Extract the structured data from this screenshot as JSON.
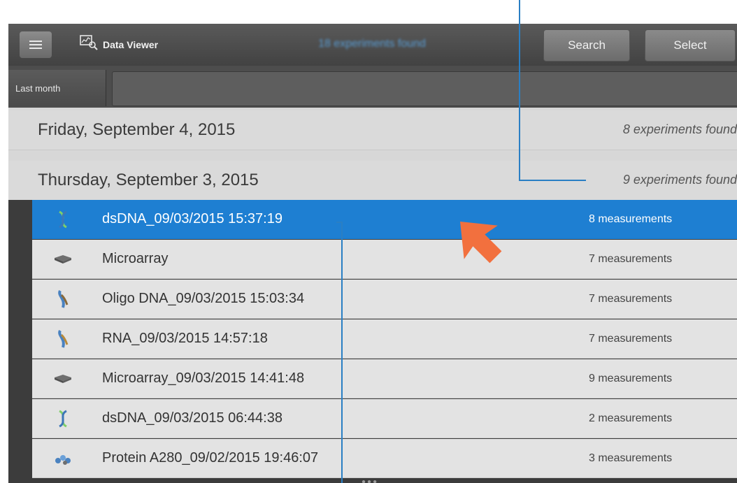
{
  "topbar": {
    "menu_icon": "hamburger-icon",
    "viewer_icon": "data-viewer-icon",
    "title": "Data Viewer",
    "center_title": "18 experiments found",
    "search_label": "Search",
    "select_label": "Select"
  },
  "filter": {
    "label": "Last month",
    "value": ""
  },
  "days": [
    {
      "label": "Friday, September 4, 2015",
      "count": "8 experiments found"
    },
    {
      "label": "Thursday, September 3, 2015",
      "count": "9 experiments found"
    }
  ],
  "experiments": [
    {
      "icon": "dsdna-icon",
      "name": "dsDNA_09/03/2015 15:37:19",
      "measurements": "8 measurements",
      "selected": true
    },
    {
      "icon": "microarray-icon",
      "name": "Microarray",
      "measurements": "7 measurements",
      "selected": false
    },
    {
      "icon": "oligo-dna-icon",
      "name": "Oligo DNA_09/03/2015 15:03:34",
      "measurements": "7 measurements",
      "selected": false
    },
    {
      "icon": "rna-icon",
      "name": "RNA_09/03/2015 14:57:18",
      "measurements": "7 measurements",
      "selected": false
    },
    {
      "icon": "microarray-icon",
      "name": "Microarray_09/03/2015 14:41:48",
      "measurements": "9 measurements",
      "selected": false
    },
    {
      "icon": "dsdna-icon",
      "name": "dsDNA_09/03/2015 06:44:38",
      "measurements": "2 measurements",
      "selected": false
    },
    {
      "icon": "protein-icon",
      "name": "Protein A280_09/02/2015 19:46:07",
      "measurements": "3 measurements",
      "selected": false
    }
  ],
  "colors": {
    "selection": "#1e7fd2",
    "callout_line": "#2a7fc4",
    "pointer_arrow": "#f2703e"
  }
}
